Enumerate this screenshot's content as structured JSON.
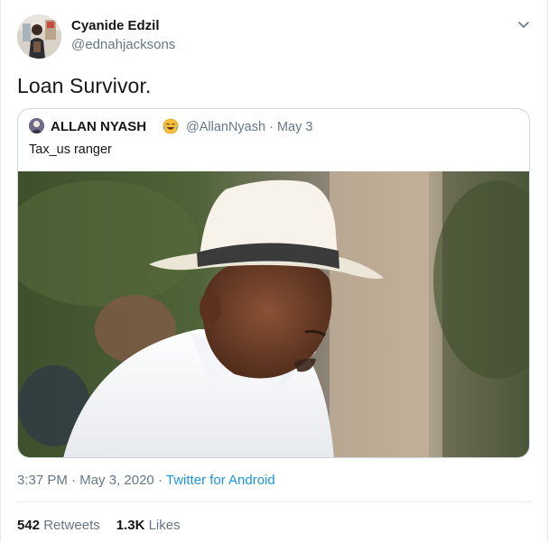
{
  "author": {
    "name": "Cyanide Edzil",
    "handle": "@ednahjacksons"
  },
  "tweet": {
    "text": "Loan Survivor."
  },
  "quoted_tweet": {
    "name": "ALLAN NYASH",
    "name_emoji": "face-with-tears-of-joy",
    "handle": "@AllanNyash",
    "separator": "·",
    "date": "May 3",
    "text": "Tax_us ranger"
  },
  "meta": {
    "time": "3:37 PM",
    "separator": "·",
    "date": "May 3, 2020",
    "source": "Twitter for Android"
  },
  "stats": {
    "retweets_count": "542",
    "retweets_label": "Retweets",
    "likes_count": "1.3K",
    "likes_label": "Likes"
  },
  "colors": {
    "link": "#1b95e0",
    "secondary_text": "#657786",
    "border": "#ccd6dd"
  }
}
